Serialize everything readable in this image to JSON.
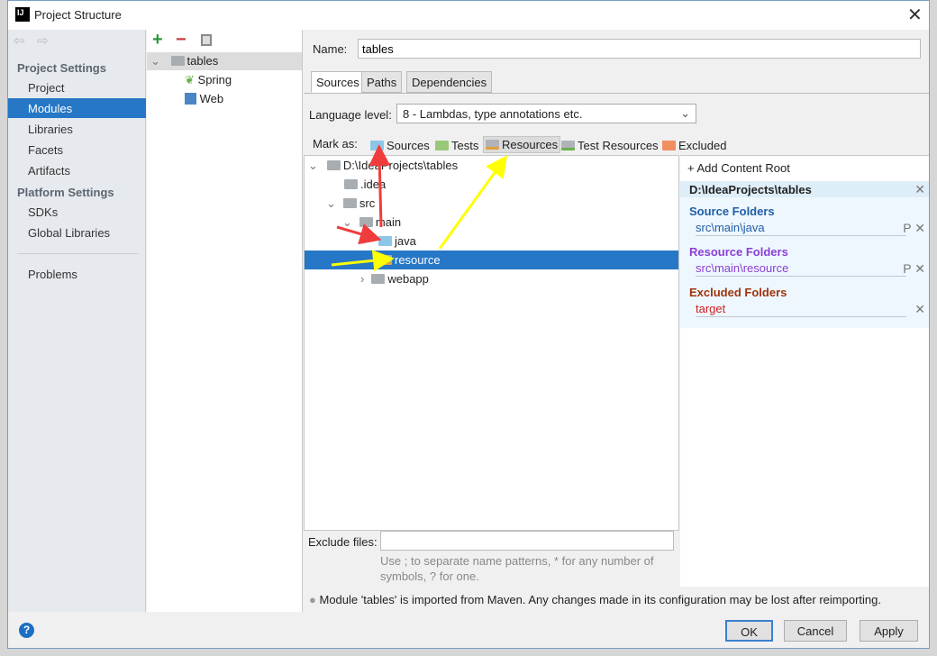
{
  "window": {
    "title": "Project Structure"
  },
  "sidebar": {
    "project_settings": "Project Settings",
    "platform_settings": "Platform Settings",
    "items": [
      "Project",
      "Modules",
      "Libraries",
      "Facets",
      "Artifacts",
      "SDKs",
      "Global Libraries",
      "Problems"
    ],
    "selected": "Modules"
  },
  "modules": {
    "root": "tables",
    "children": [
      "Spring",
      "Web"
    ]
  },
  "main": {
    "name_label": "Name:",
    "name_value": "tables",
    "tabs": [
      "Sources",
      "Paths",
      "Dependencies"
    ],
    "active_tab": "Sources",
    "language_label": "Language level:",
    "language_value": "8 - Lambdas, type annotations etc.",
    "mark_as_label": "Mark as:",
    "mark_as": [
      "Sources",
      "Tests",
      "Resources",
      "Test Resources",
      "Excluded"
    ],
    "tree": [
      "D:\\IdeaProjects\\tables",
      ".idea",
      "src",
      "main",
      "java",
      "resource",
      "webapp"
    ],
    "selected_node": "resource",
    "exclude_label": "Exclude files:",
    "exclude_value": "",
    "exclude_hint": "Use ; to separate name patterns, * for any number of symbols, ? for one.",
    "info": "Module 'tables' is imported from Maven. Any changes made in its configuration may be lost after reimporting."
  },
  "content_root": {
    "add": "Add Content Root",
    "path": "D:\\IdeaProjects\\tables",
    "source_title": "Source Folders",
    "source": "src\\main\\java",
    "resource_title": "Resource Folders",
    "resource": "src\\main\\resource",
    "excluded_title": "Excluded Folders",
    "excluded": "target"
  },
  "buttons": {
    "ok": "OK",
    "cancel": "Cancel",
    "apply": "Apply"
  },
  "colors": {
    "selection": "#2677c6",
    "source": "#1f5ea8",
    "resource": "#8a3fd6",
    "excluded": "#a0330e",
    "annotation_red": "#f03c3c",
    "annotation_yellow": "#ffff00"
  }
}
